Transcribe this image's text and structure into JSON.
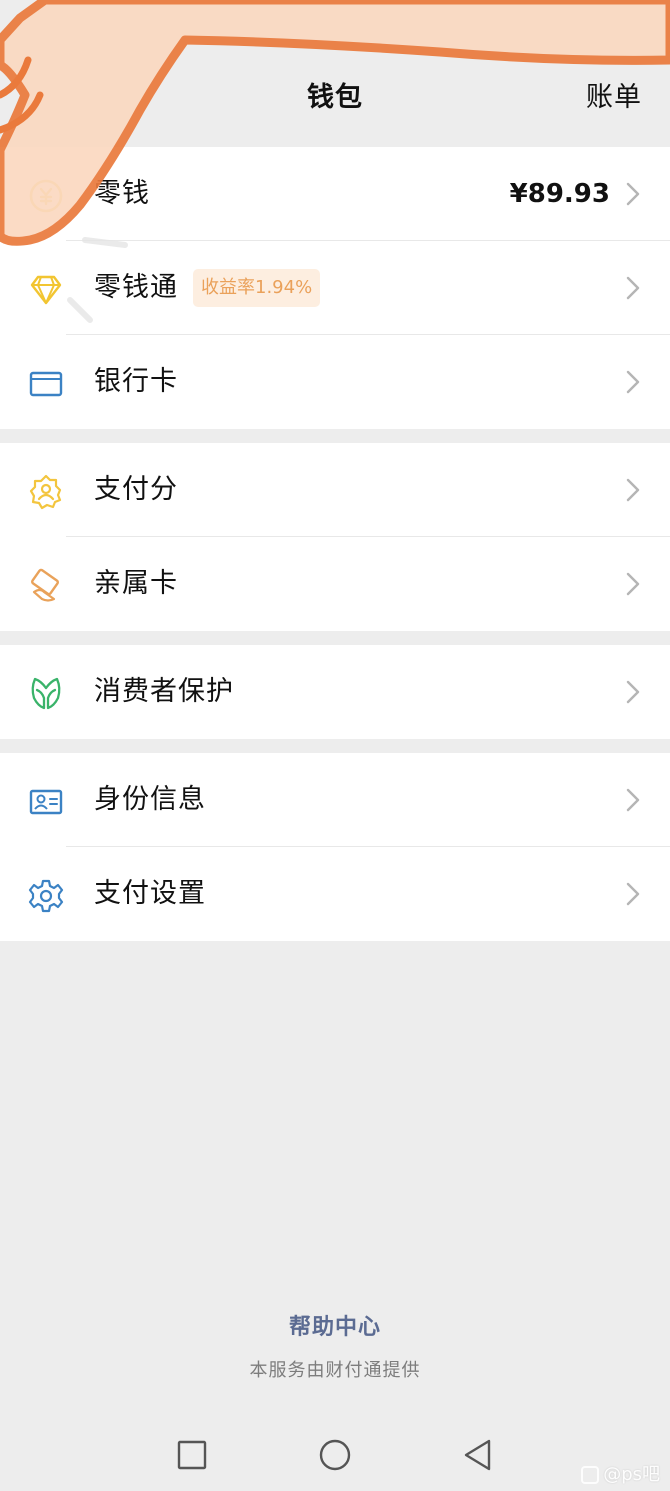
{
  "header": {
    "title": "钱包",
    "bill_label": "账单"
  },
  "groups": [
    {
      "items": [
        {
          "label": "零钱",
          "icon": "coin-icon",
          "amount": "¥89.93"
        },
        {
          "label": "零钱通",
          "icon": "diamond-icon",
          "badge": "收益率1.94%"
        },
        {
          "label": "银行卡",
          "icon": "bank-card-icon"
        }
      ]
    },
    {
      "items": [
        {
          "label": "支付分",
          "icon": "badge-score-icon"
        },
        {
          "label": "亲属卡",
          "icon": "family-card-icon"
        }
      ]
    },
    {
      "items": [
        {
          "label": "消费者保护",
          "icon": "protecting-hands-icon"
        }
      ]
    },
    {
      "items": [
        {
          "label": "身份信息",
          "icon": "id-card-icon"
        },
        {
          "label": "支付设置",
          "icon": "gear-icon"
        }
      ]
    }
  ],
  "footer": {
    "help_center": "帮助中心",
    "service_note": "本服务由财付通提供"
  },
  "watermark": {
    "text": "@ps吧"
  },
  "colors": {
    "page_bg": "#ededed",
    "card_bg": "#ffffff",
    "coin_yellow": "#f4c63d",
    "diamond_yellow": "#f2c531",
    "bank_blue": "#3b82c4",
    "score_yellow": "#f3c53e",
    "family_orange": "#e9a25a",
    "protect_green": "#3ab36a",
    "id_blue": "#3b82c4",
    "gear_blue": "#3b82c4",
    "badge_bg": "#fdeee0",
    "badge_text": "#eaa15a",
    "help_text": "#5b6b92",
    "doodle_fill": "#fbd9c1",
    "doodle_stroke": "#ea7a3c"
  }
}
